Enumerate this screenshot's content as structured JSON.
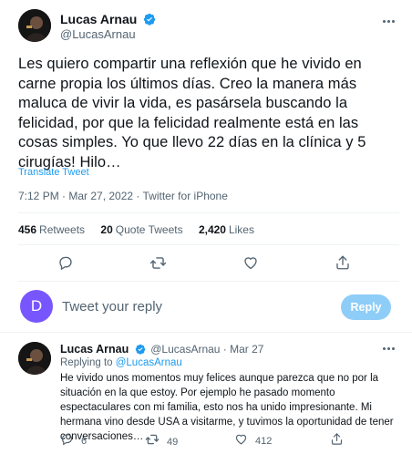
{
  "main_tweet": {
    "author_name": "Lucas Arnau",
    "author_handle": "@LucasArnau",
    "text": "Les quiero compartir una reflexión que he vivido en carne propia los últimos días. Creo la manera más maluca de vivir la vida, es pasársela buscando la felicidad, por que la felicidad realmente está en las cosas simples. Yo que llevo 22 días en la clínica y 5 cirugías! Hilo…",
    "translate_label": "Translate Tweet",
    "timestamp": "7:12 PM · Mar 27, 2022 · Twitter for iPhone",
    "stats": {
      "retweets_count": "456",
      "retweets_label": "Retweets",
      "quote_count": "20",
      "quote_label": "Quote Tweets",
      "likes_count": "2,420",
      "likes_label": "Likes"
    }
  },
  "reply_composer": {
    "avatar_letter": "D",
    "placeholder": "Tweet your reply",
    "button_label": "Reply"
  },
  "reply_tweet": {
    "author_name": "Lucas Arnau",
    "author_handle_date": "@LucasArnau · Mar 27",
    "replying_prefix": "Replying to ",
    "replying_handle": "@LucasArnau",
    "text": "He vivido unos momentos muy felices aunque parezca que no por la situación en la que estoy. Por ejemplo he pasado momento espectaculares con mi familia, esto nos ha unido impresionante. Mi hermana vino desde USA a visitarme, y tuvimos la oportunidad de tener conversaciones…",
    "reply_count": "6",
    "retweet_count": "49",
    "like_count": "412"
  },
  "colors": {
    "accent": "#1d9bf0",
    "reply_button_disabled": "#8ecdf8",
    "composer_avatar": "#7856ff"
  }
}
